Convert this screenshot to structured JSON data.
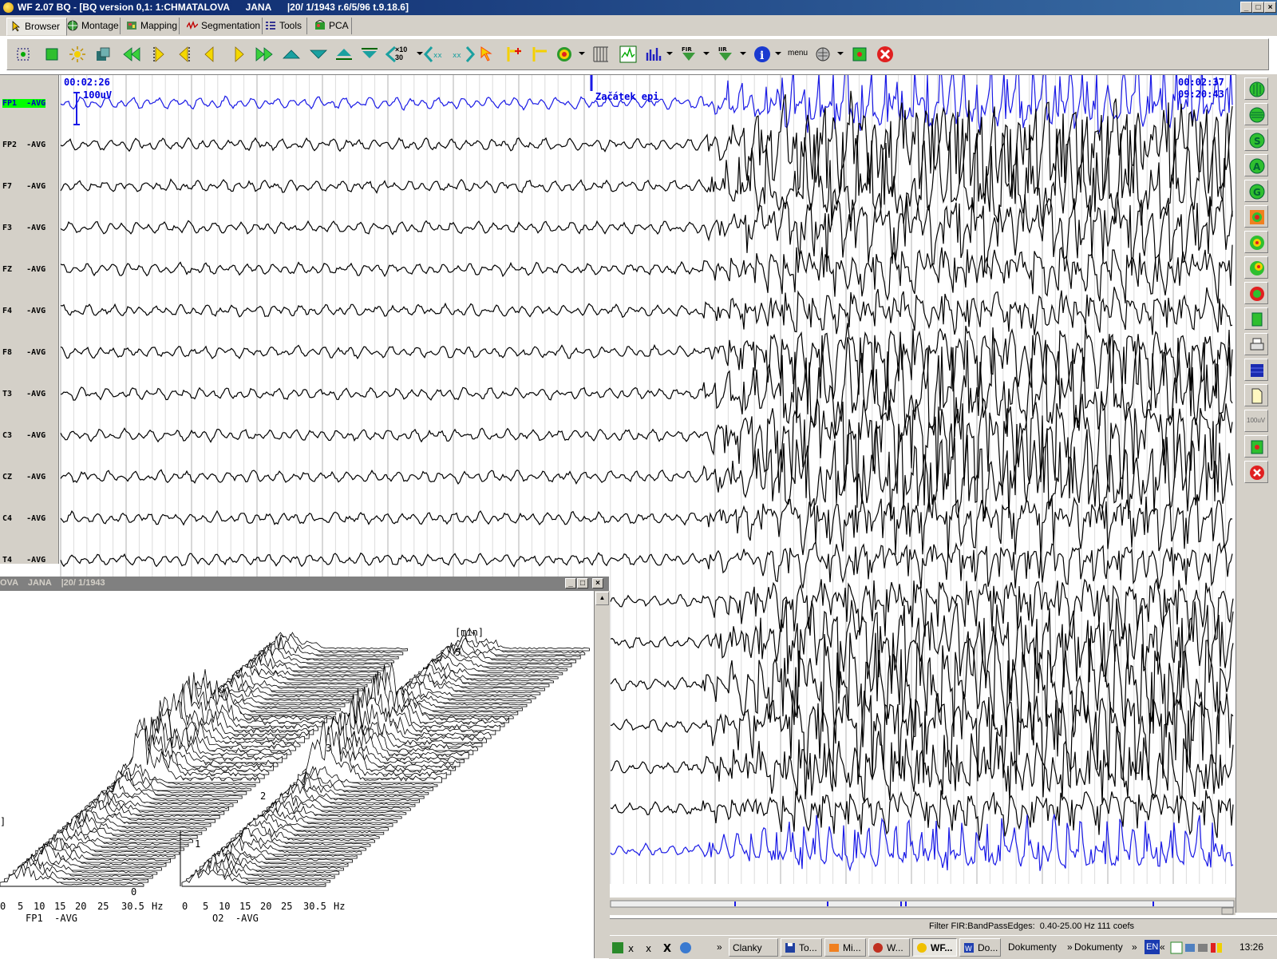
{
  "app": {
    "title": "WF 2.07 BQ - [BQ version 0,1: 1:CHMATALOVA      JANA      |20/ 1/1943 r.6/5/96 t.9.18.6]",
    "window_buttons": [
      "_",
      "□",
      "×"
    ]
  },
  "tabs": [
    {
      "label": "Browser",
      "icon": "pointer-icon",
      "active": true
    },
    {
      "label": "Montage",
      "icon": "head-icon"
    },
    {
      "label": "Mapping",
      "icon": "map-icon"
    },
    {
      "label": "Segmentation",
      "icon": "wave-icon"
    },
    {
      "label": "Tools",
      "icon": "list-icon"
    },
    {
      "label": "PCA",
      "icon": "pca-icon"
    }
  ],
  "toolbar": {
    "text_buttons": {
      "zoom": "×10\n30",
      "menu": "menu"
    }
  },
  "eeg": {
    "time_start": "00:02:26",
    "time_end": "00:02:37",
    "clock": "09:20:43",
    "scale_label": "100uV",
    "marker_label": "Začátek epi",
    "channels": [
      {
        "name": "FP1",
        "ref": "-AVG",
        "selected": true
      },
      {
        "name": "FP2",
        "ref": "-AVG"
      },
      {
        "name": "F7",
        "ref": "-AVG"
      },
      {
        "name": "F3",
        "ref": "-AVG"
      },
      {
        "name": "FZ",
        "ref": "-AVG"
      },
      {
        "name": "F4",
        "ref": "-AVG"
      },
      {
        "name": "F8",
        "ref": "-AVG"
      },
      {
        "name": "T3",
        "ref": "-AVG"
      },
      {
        "name": "C3",
        "ref": "-AVG"
      },
      {
        "name": "CZ",
        "ref": "-AVG"
      },
      {
        "name": "C4",
        "ref": "-AVG"
      },
      {
        "name": "T4",
        "ref": "-AVG"
      }
    ],
    "colors": {
      "highlight_trace": "#1a1ae6",
      "normal_trace": "#000000",
      "selected_label_bg": "#00ff00"
    }
  },
  "sidebar": {
    "scale_button": "100uV"
  },
  "status": {
    "filter": "Filter FIR:BandPassEdges:  0.40-25.00 Hz 111 coefs"
  },
  "taskbar": {
    "items": [
      "Clanky",
      "To...",
      "Mi...",
      "W...",
      "WF...",
      "Do...",
      "Dokumenty",
      "Dokumenty"
    ],
    "lang": "EN",
    "clock": "13:26"
  },
  "spectrum_window": {
    "title": "OVA    JANA    |20/ 1/1943",
    "unit_label": "[min]",
    "time_ticks": [
      "5",
      "3",
      "2",
      "1",
      "0"
    ],
    "freq_ticks": [
      "0",
      "5",
      "10",
      "15",
      "20",
      "25",
      "30.5",
      "Hz"
    ],
    "left_channel": "FP1  -AVG",
    "right_channel": "O2  -AVG",
    "partial_bracket": "]"
  }
}
